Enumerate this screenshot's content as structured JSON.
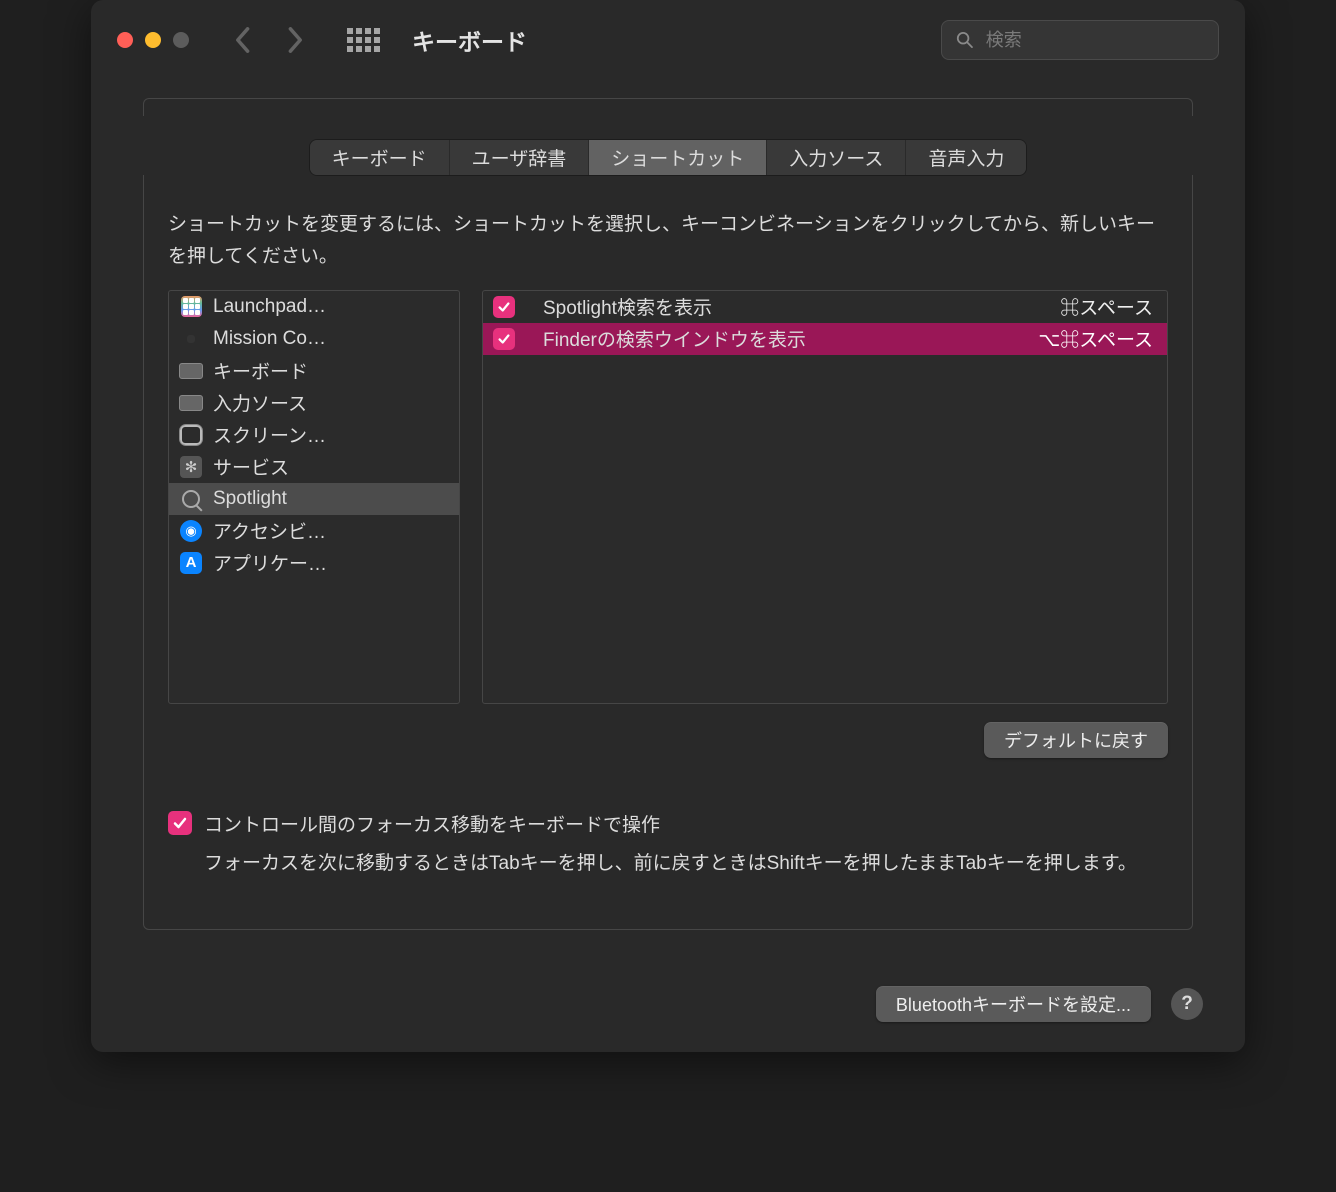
{
  "window": {
    "title": "キーボード",
    "search_placeholder": "検索"
  },
  "tabs": [
    {
      "label": "キーボード",
      "active": false
    },
    {
      "label": "ユーザ辞書",
      "active": false
    },
    {
      "label": "ショートカット",
      "active": true
    },
    {
      "label": "入力ソース",
      "active": false
    },
    {
      "label": "音声入力",
      "active": false
    }
  ],
  "instructions": "ショートカットを変更するには、ショートカットを選択し、キーコンビネーションをクリックしてから、新しいキーを押してください。",
  "categories": [
    {
      "icon": "launchpad",
      "label": "Launchpad…",
      "selected": false
    },
    {
      "icon": "mission",
      "label": "Mission Co…",
      "selected": false
    },
    {
      "icon": "keyboard",
      "label": "キーボード",
      "selected": false
    },
    {
      "icon": "input",
      "label": "入力ソース",
      "selected": false
    },
    {
      "icon": "screenshot",
      "label": "スクリーン…",
      "selected": false
    },
    {
      "icon": "services",
      "label": "サービス",
      "selected": false
    },
    {
      "icon": "spotlight",
      "label": "Spotlight",
      "selected": true
    },
    {
      "icon": "access",
      "label": "アクセシビ…",
      "selected": false
    },
    {
      "icon": "app",
      "label": "アプリケー…",
      "selected": false
    }
  ],
  "shortcuts": [
    {
      "checked": true,
      "label": "Spotlight検索を表示",
      "keys": "⌘スペース",
      "selected": false
    },
    {
      "checked": true,
      "label": "Finderの検索ウインドウを表示",
      "keys": "⌥⌘スペース",
      "selected": true
    }
  ],
  "restore_defaults_label": "デフォルトに戻す",
  "keyboard_nav": {
    "checked": true,
    "label": "コントロール間のフォーカス移動をキーボードで操作",
    "description": "フォーカスを次に移動するときはTabキーを押し、前に戻すときはShiftキーを押したままTabキーを押します。"
  },
  "footer": {
    "bluetooth_label": "Bluetoothキーボードを設定...",
    "help_label": "?"
  }
}
